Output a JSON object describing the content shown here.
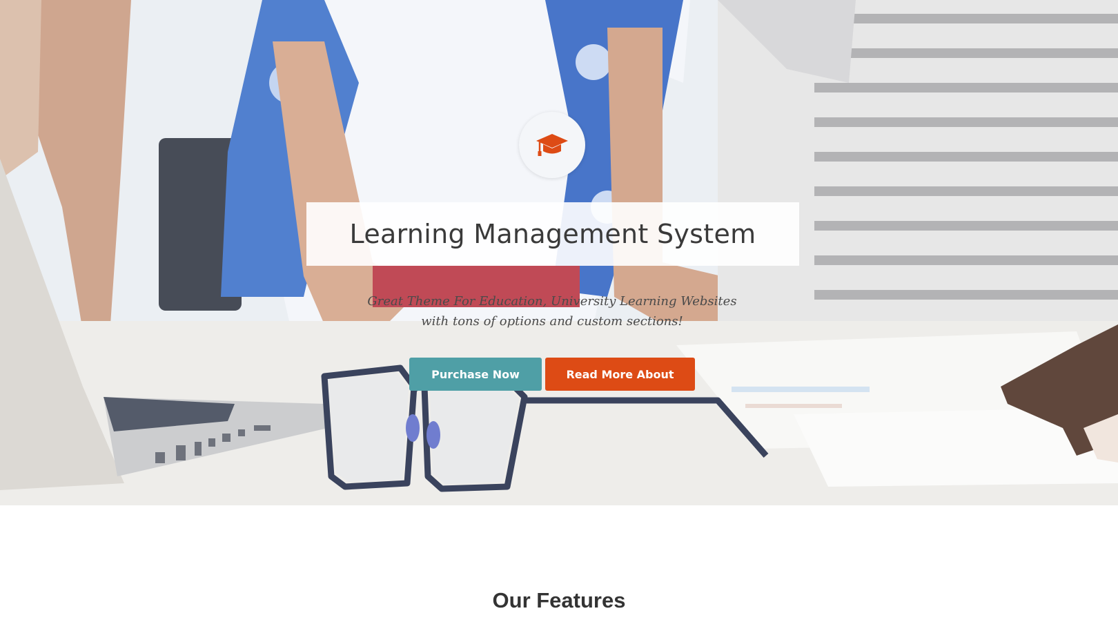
{
  "hero": {
    "icon": "graduation-cap-icon",
    "title": "Learning Management System",
    "subtitle_line1": "Great Theme For Education, University Learning Websites",
    "subtitle_line2": "with tons of options and custom sections!",
    "buttons": {
      "purchase_label": "Purchase Now",
      "read_more_label": "Read More About"
    },
    "colors": {
      "purchase": "#4f9fa6",
      "read_more": "#dd4b15",
      "icon": "#dd4b15"
    }
  },
  "features": {
    "title": "Our Features"
  }
}
